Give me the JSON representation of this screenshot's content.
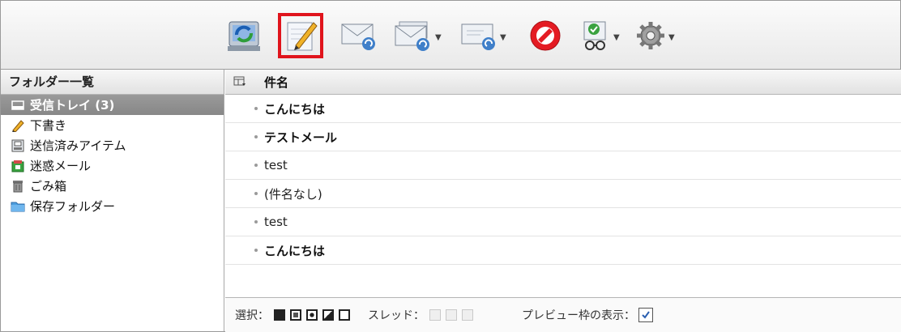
{
  "folders_title": "フォルダー一覧",
  "folders": [
    {
      "label": "受信トレイ (3)",
      "icon": "inbox-icon",
      "selected": true
    },
    {
      "label": "下書き",
      "icon": "pencil-icon",
      "selected": false
    },
    {
      "label": "送信済みアイテム",
      "icon": "sent-items-icon",
      "selected": false
    },
    {
      "label": "迷惑メール",
      "icon": "junk-mail-icon",
      "selected": false
    },
    {
      "label": "ごみ箱",
      "icon": "trash-icon",
      "selected": false
    },
    {
      "label": "保存フォルダー",
      "icon": "folder-icon",
      "selected": false
    }
  ],
  "list": {
    "subject_header": "件名",
    "messages": [
      {
        "subject": "こんにちは",
        "unread": true
      },
      {
        "subject": "テストメール",
        "unread": true
      },
      {
        "subject": "test",
        "unread": false
      },
      {
        "subject": "(件名なし)",
        "unread": false
      },
      {
        "subject": "test",
        "unread": false
      },
      {
        "subject": "こんにちは",
        "unread": true
      }
    ]
  },
  "status": {
    "select_label": "選択：",
    "thread_label": "スレッド：",
    "preview_label": "プレビュー枠の表示：",
    "preview_checked": true
  },
  "toolbar": {
    "buttons": [
      "refresh-icon",
      "compose-icon",
      "reply-icon",
      "reply-all-icon",
      "forward-icon",
      "delete-icon",
      "mark-icon",
      "settings-icon"
    ],
    "highlighted": "compose-icon",
    "highlight_color": "#e0141c"
  }
}
